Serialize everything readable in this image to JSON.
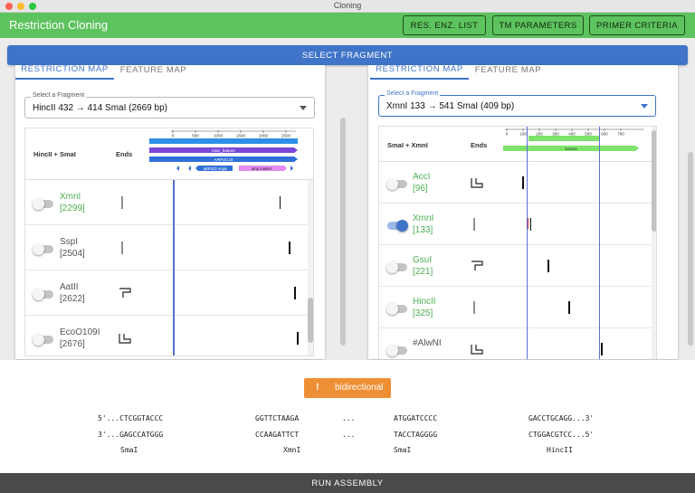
{
  "window": {
    "title": "Cloning"
  },
  "app": {
    "title": "Restriction Cloning",
    "buttons": [
      "RES. ENZ. LIST",
      "TM PARAMETERS",
      "PRIMER CRITERIA"
    ]
  },
  "select_fragment_label": "SELECT FRAGMENT",
  "left_panel": {
    "tabs": [
      "RESTRICTION MAP",
      "FEATURE MAP"
    ],
    "fragment_label": "Select a Fragment",
    "fragment_value": "HincII 432 → 414 SmaI (2669 bp)",
    "header": {
      "title": "HincII + SmaI",
      "ends": "Ends"
    },
    "axis_ticks": [
      "0",
      "500",
      "1000",
      "1500",
      "2000",
      "2500"
    ],
    "features": [
      "misc_feature",
      "ARPUC19",
      "pBR322 origin",
      "amp marker"
    ],
    "rows": [
      {
        "name": "XmnI",
        "pos": "[2299]",
        "color": "green",
        "toggled": false,
        "end": "blunt",
        "cut": 0.858
      },
      {
        "name": "SspI",
        "pos": "[2504]",
        "color": "gray",
        "toggled": false,
        "end": "blunt",
        "cut": 0.935
      },
      {
        "name": "AatII",
        "pos": "[2622]",
        "color": "gray",
        "toggled": false,
        "end": "overhang3",
        "cut": 0.98
      },
      {
        "name": "EcoO109I",
        "pos": "[2676]",
        "color": "gray",
        "toggled": false,
        "end": "overhang5",
        "cut": 1.0
      }
    ]
  },
  "right_panel": {
    "tabs": [
      "RESTRICTION MAP",
      "FEATURE MAP"
    ],
    "fragment_label": "Select a Fragment",
    "fragment_value": "XmnI 133 → 541 SmaI (409 bp)",
    "header": {
      "title": "SmaI + XmnI",
      "ends": "Ends"
    },
    "axis_ticks": [
      "0",
      "100",
      "200",
      "300",
      "400",
      "500",
      "600",
      "700"
    ],
    "features": [
      "source"
    ],
    "rows": [
      {
        "name": "AccI",
        "pos": "[96]",
        "color": "green",
        "toggled": false,
        "end": "overhang5",
        "cut": 0.136
      },
      {
        "name": "XmnI",
        "pos": "[133]",
        "color": "green",
        "toggled": true,
        "end": "blunt",
        "cut": 0.188
      },
      {
        "name": "GsuI",
        "pos": "[221]",
        "color": "green",
        "toggled": false,
        "end": "overhang3",
        "cut": 0.313
      },
      {
        "name": "HincII",
        "pos": "[325]",
        "color": "green",
        "toggled": false,
        "end": "blunt",
        "cut": 0.46
      },
      {
        "name": "#AlwNI",
        "pos": "",
        "color": "gray",
        "toggled": false,
        "end": "overhang5",
        "cut": 0.69
      }
    ]
  },
  "junction": {
    "badge_icon": "!",
    "badge_text": "bidirectional",
    "top": [
      "5'...CTCGGTACCC",
      "GGTTCTAAGA",
      "...",
      "ATGGATCCCC",
      "GACCTGCAGG...3'"
    ],
    "bottom": [
      "3'...GAGCCATGGG",
      "CCAAGATTCT",
      "...",
      "TACCTAGGGG",
      "CTGGACGTCC...5'"
    ],
    "enzymes": [
      "SmaI",
      "XmnI",
      "SmaI",
      "HincII"
    ]
  },
  "run_label": "RUN ASSEMBLY",
  "colors": {
    "appbar": "#5dc35e",
    "primary": "#3f74c8",
    "badge": "#ef8f35",
    "run_bar": "#4a4a4a",
    "feature_blue": "#2f6fd8",
    "feature_purple": "#7a47d6",
    "feature_pink": "#e48cf3",
    "feature_green": "#7ee36a"
  }
}
